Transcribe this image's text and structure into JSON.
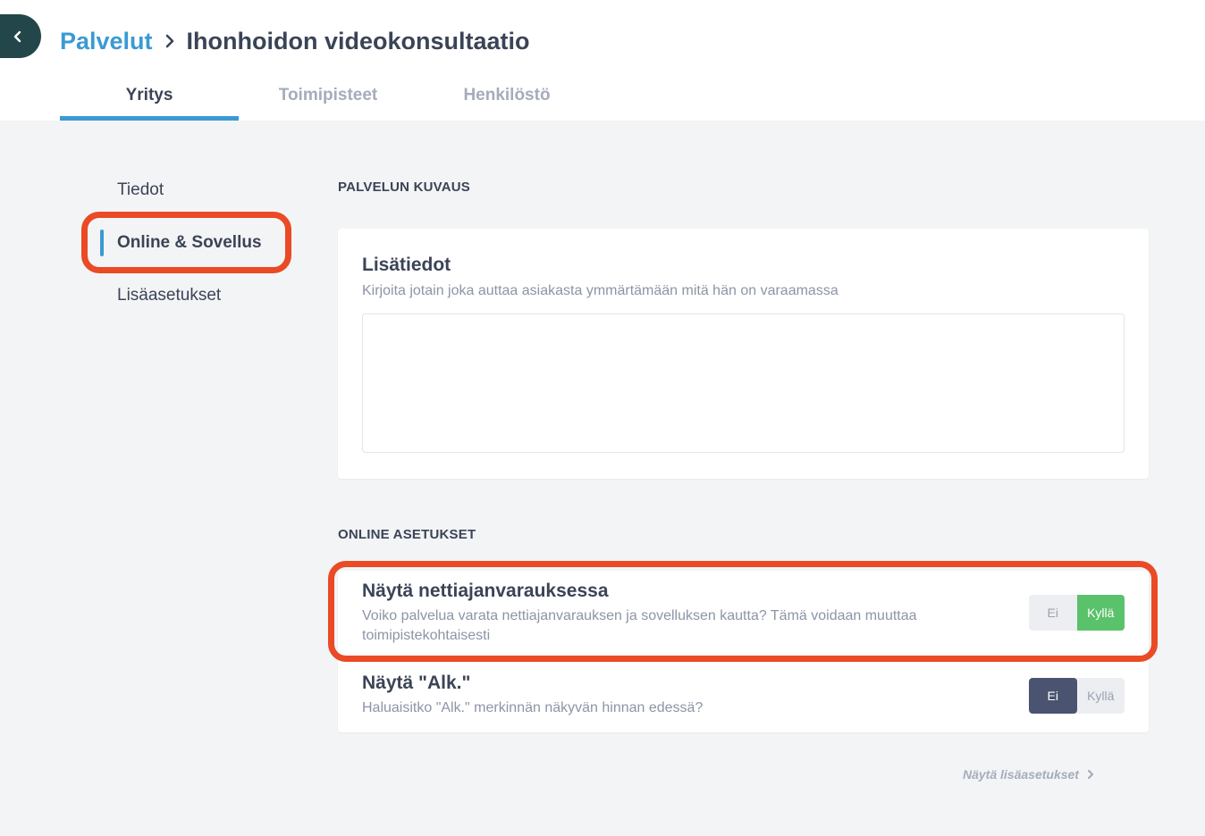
{
  "header": {
    "breadcrumb_parent": "Palvelut",
    "breadcrumb_current": "Ihonhoidon videokonsultaatio"
  },
  "tabs": [
    {
      "label": "Yritys",
      "active": true
    },
    {
      "label": "Toimipisteet",
      "active": false
    },
    {
      "label": "Henkilöstö",
      "active": false
    }
  ],
  "sidebar": {
    "items": [
      {
        "label": "Tiedot"
      },
      {
        "label": "Online & Sovellus"
      },
      {
        "label": "Lisäasetukset"
      }
    ]
  },
  "description_section": {
    "heading": "PALVELUN KUVAUS",
    "card_title": "Lisätiedot",
    "card_desc": "Kirjoita jotain joka auttaa asiakasta ymmärtämään mitä hän on varaamassa",
    "textarea_value": ""
  },
  "online_section": {
    "heading": "ONLINE ASETUKSET",
    "settings": [
      {
        "title": "Näytä nettiajanvarauksessa",
        "desc": "Voiko palvelua varata nettiajanvarauksen ja sovelluksen kautta? Tämä voidaan muuttaa toimipistekohtaisesti",
        "off_label": "Ei",
        "on_label": "Kyllä",
        "value": "Kyllä"
      },
      {
        "title": "Näytä \"Alk.\"",
        "desc": "Haluaisitko \"Alk.\" merkinnän näkyvän hinnan edessä?",
        "off_label": "Ei",
        "on_label": "Kyllä",
        "value": "Ei"
      }
    ]
  },
  "footer": {
    "more_link": "Näytä lisäasetukset"
  },
  "colors": {
    "accent": "#3a9ad3",
    "toggle_on": "#5ac26a",
    "toggle_off_active": "#4a5470",
    "highlight": "#ea4a25",
    "back_button": "#23464a"
  }
}
